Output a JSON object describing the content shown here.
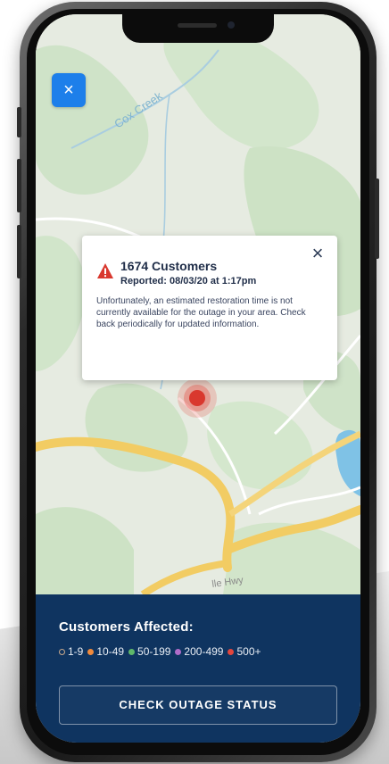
{
  "map": {
    "labels": {
      "creek": "Cox Creek",
      "highway": "lle Hwy"
    }
  },
  "close_button": {
    "label": "×"
  },
  "popup": {
    "title": "1674 Customers",
    "reported": "Reported: 08/03/20 at 1:17pm",
    "message": "Unfortunately, an estimated restoration time is not currently available for the outage in your area. Check back periodically for updated information.",
    "close_label": "×",
    "icon": "warning-triangle-icon",
    "icon_color": "#d9382e"
  },
  "legend": {
    "title": "Customers Affected:",
    "items": [
      {
        "label": "1-9",
        "color": "#0f3460",
        "outline": "#c9a98b"
      },
      {
        "label": "10-49",
        "color": "#f08a3c"
      },
      {
        "label": "50-199",
        "color": "#5fb86a"
      },
      {
        "label": "200-499",
        "color": "#b06cc9"
      },
      {
        "label": "500+",
        "color": "#e2463d"
      }
    ]
  },
  "cta": {
    "label": "CHECK OUTAGE STATUS"
  },
  "colors": {
    "panel": "#0f3460",
    "accent_button": "#1d7fea",
    "map_base": "#e7ece3",
    "road": "#f2cc63",
    "marker": "#d9382e"
  }
}
